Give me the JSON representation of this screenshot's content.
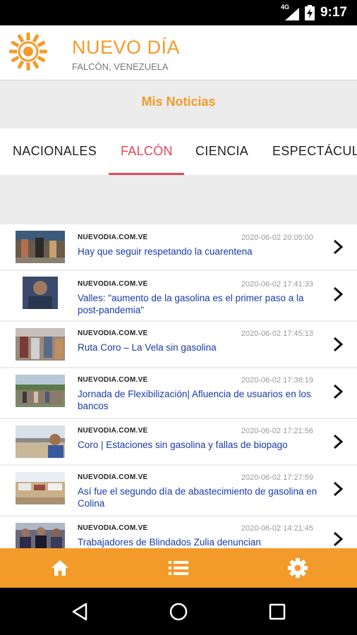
{
  "status_bar": {
    "network": "4G",
    "time": "9:17"
  },
  "header": {
    "title": "NUEVO DÍA",
    "subtitle": "FALCÓN, VENEZUELA"
  },
  "section": {
    "label": "Mis Noticias"
  },
  "tabs": [
    {
      "label": "NACIONALES",
      "active": false
    },
    {
      "label": "FALCÓN",
      "active": true
    },
    {
      "label": "CIENCIA",
      "active": false
    },
    {
      "label": "ESPECTÁCULOS",
      "active": false
    }
  ],
  "news": [
    {
      "source": "NUEVODIA.COM.VE",
      "date": "2020-06-02 20:05:00",
      "title": "Hay que seguir respetando la cuarentena"
    },
    {
      "source": "NUEVODIA.COM.VE",
      "date": "2020-06-02 17:41:33",
      "title": "Valles: \"aumento de la gasolina es el primer paso a la post-pandemia\""
    },
    {
      "source": "NUEVODIA.COM.VE",
      "date": "2020-06-02 17:45:13",
      "title": "Ruta Coro – La Vela sin gasolina"
    },
    {
      "source": "NUEVODIA.COM.VE",
      "date": "2020-06-02 17:38:19",
      "title": "Jornada de Flexibilización| Afluencia de usuarios en los bancos"
    },
    {
      "source": "NUEVODIA.COM.VE",
      "date": "2020-06-02 17:21:56",
      "title": "Coro | Estaciones sin gasolina y fallas de biopago"
    },
    {
      "source": "NUEVODIA.COM.VE",
      "date": "2020-06-02 17:27:59",
      "title": "Así fue el segundo día de abastecimiento de gasolina en Colina"
    },
    {
      "source": "NUEVODIA.COM.VE",
      "date": "2020-06-02 14:21:45",
      "title": "Trabajadores de Blindados Zulia denuncian"
    }
  ],
  "bottom_nav": [
    "home-icon",
    "list-icon",
    "gear-icon"
  ],
  "colors": {
    "brand": "#f39b2a",
    "accent": "#e0495a",
    "link": "#1a3aa8"
  }
}
